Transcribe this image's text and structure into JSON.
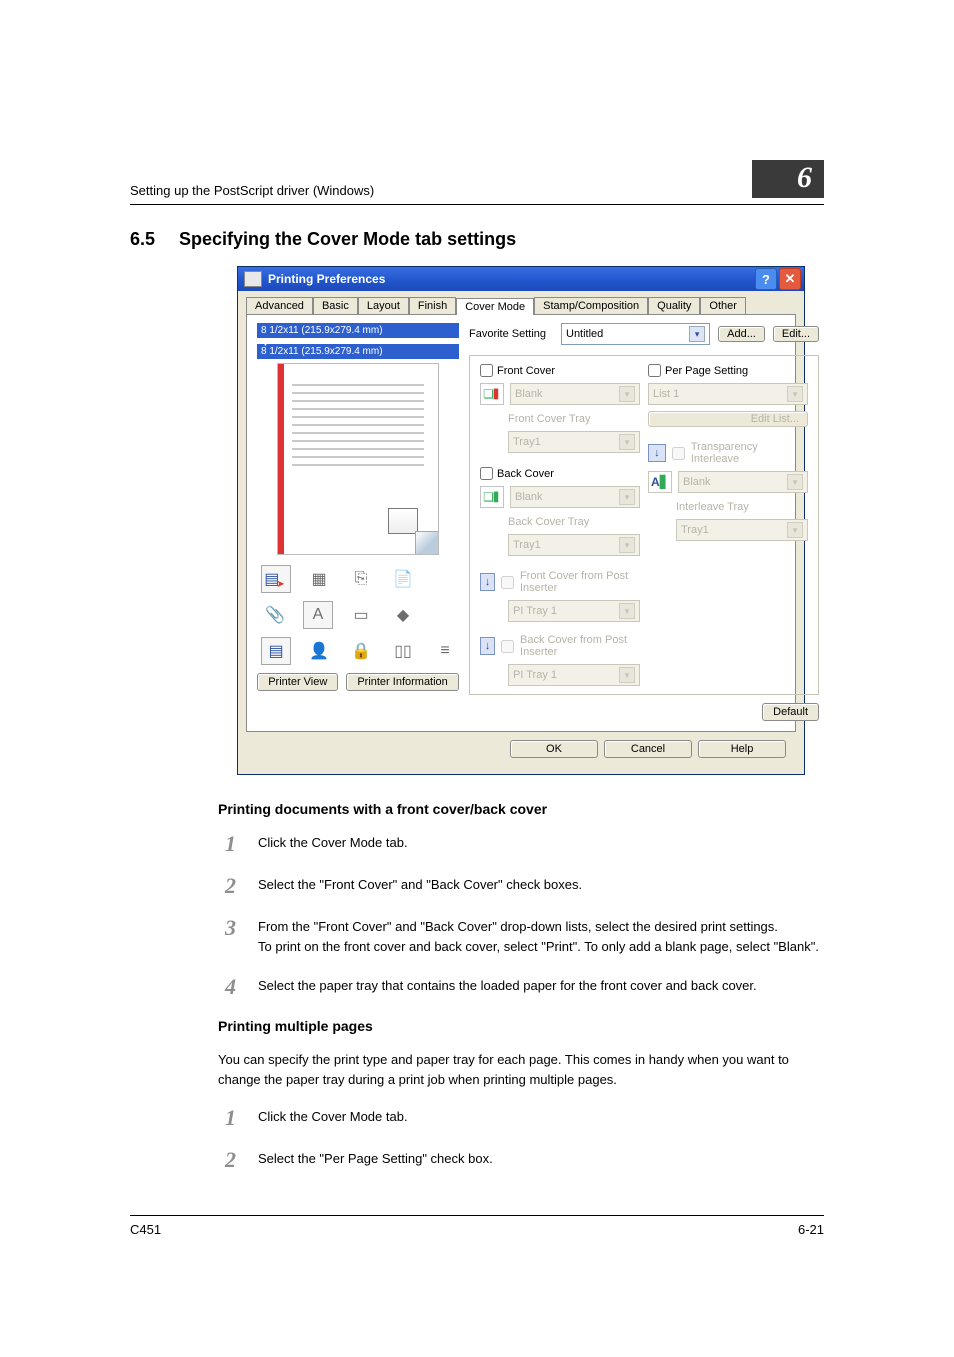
{
  "running_header": "Setting up the PostScript driver (Windows)",
  "chapter_number": "6",
  "section_number": "6.5",
  "section_title": "Specifying the Cover Mode tab settings",
  "dialog": {
    "title": "Printing Preferences",
    "tabs": {
      "advanced": "Advanced",
      "basic": "Basic",
      "layout": "Layout",
      "finish": "Finish",
      "covermode": "Cover Mode",
      "stamp": "Stamp/Composition",
      "quality": "Quality",
      "other": "Other"
    },
    "paper_label_1": "8 1/2x11 (215.9x279.4 mm)",
    "paper_label_2": "8 1/2x11 (215.9x279.4 mm)",
    "favorite_label": "Favorite Setting",
    "favorite_value": "Untitled",
    "add_btn": "Add...",
    "edit_btn": "Edit...",
    "front_cover": "Front Cover",
    "front_cover_mode": "Blank",
    "front_cover_tray_label": "Front Cover Tray",
    "front_cover_tray": "Tray1",
    "back_cover": "Back Cover",
    "back_cover_mode": "Blank",
    "back_cover_tray_label": "Back Cover Tray",
    "back_cover_tray": "Tray1",
    "front_inserter": "Front Cover from Post Inserter",
    "front_inserter_tray": "PI Tray 1",
    "back_inserter": "Back Cover from Post Inserter",
    "back_inserter_tray": "PI Tray 1",
    "per_page": "Per Page Setting",
    "per_page_value": "List 1",
    "edit_list": "Edit List...",
    "transparency": "Transparency Interleave",
    "transparency_value": "Blank",
    "interleave_tray_label": "Interleave Tray",
    "interleave_tray": "Tray1",
    "printer_view": "Printer View",
    "printer_info": "Printer Information",
    "default_btn": "Default",
    "ok_btn": "OK",
    "cancel_btn": "Cancel",
    "help_btn": "Help"
  },
  "sub1": {
    "heading": "Printing documents with a front cover/back cover",
    "step1": "Click the Cover Mode tab.",
    "step2": "Select the \"Front Cover\" and \"Back Cover\" check boxes.",
    "step3a": "From the \"Front Cover\" and \"Back Cover\" drop-down lists, select the desired print settings.",
    "step3b": "To print on the front cover and back cover, select \"Print\". To only add a blank page, select \"Blank\".",
    "step4": "Select the paper tray that contains the loaded paper for the front cover and back cover."
  },
  "sub2": {
    "heading": "Printing multiple pages",
    "intro": "You can specify the print type and paper tray for each page. This comes in handy when you want to change the paper tray during a print job when printing multiple pages.",
    "step1": "Click the Cover Mode tab.",
    "step2": "Select the \"Per Page Setting\" check box."
  },
  "footer_left": "C451",
  "footer_right": "6-21"
}
